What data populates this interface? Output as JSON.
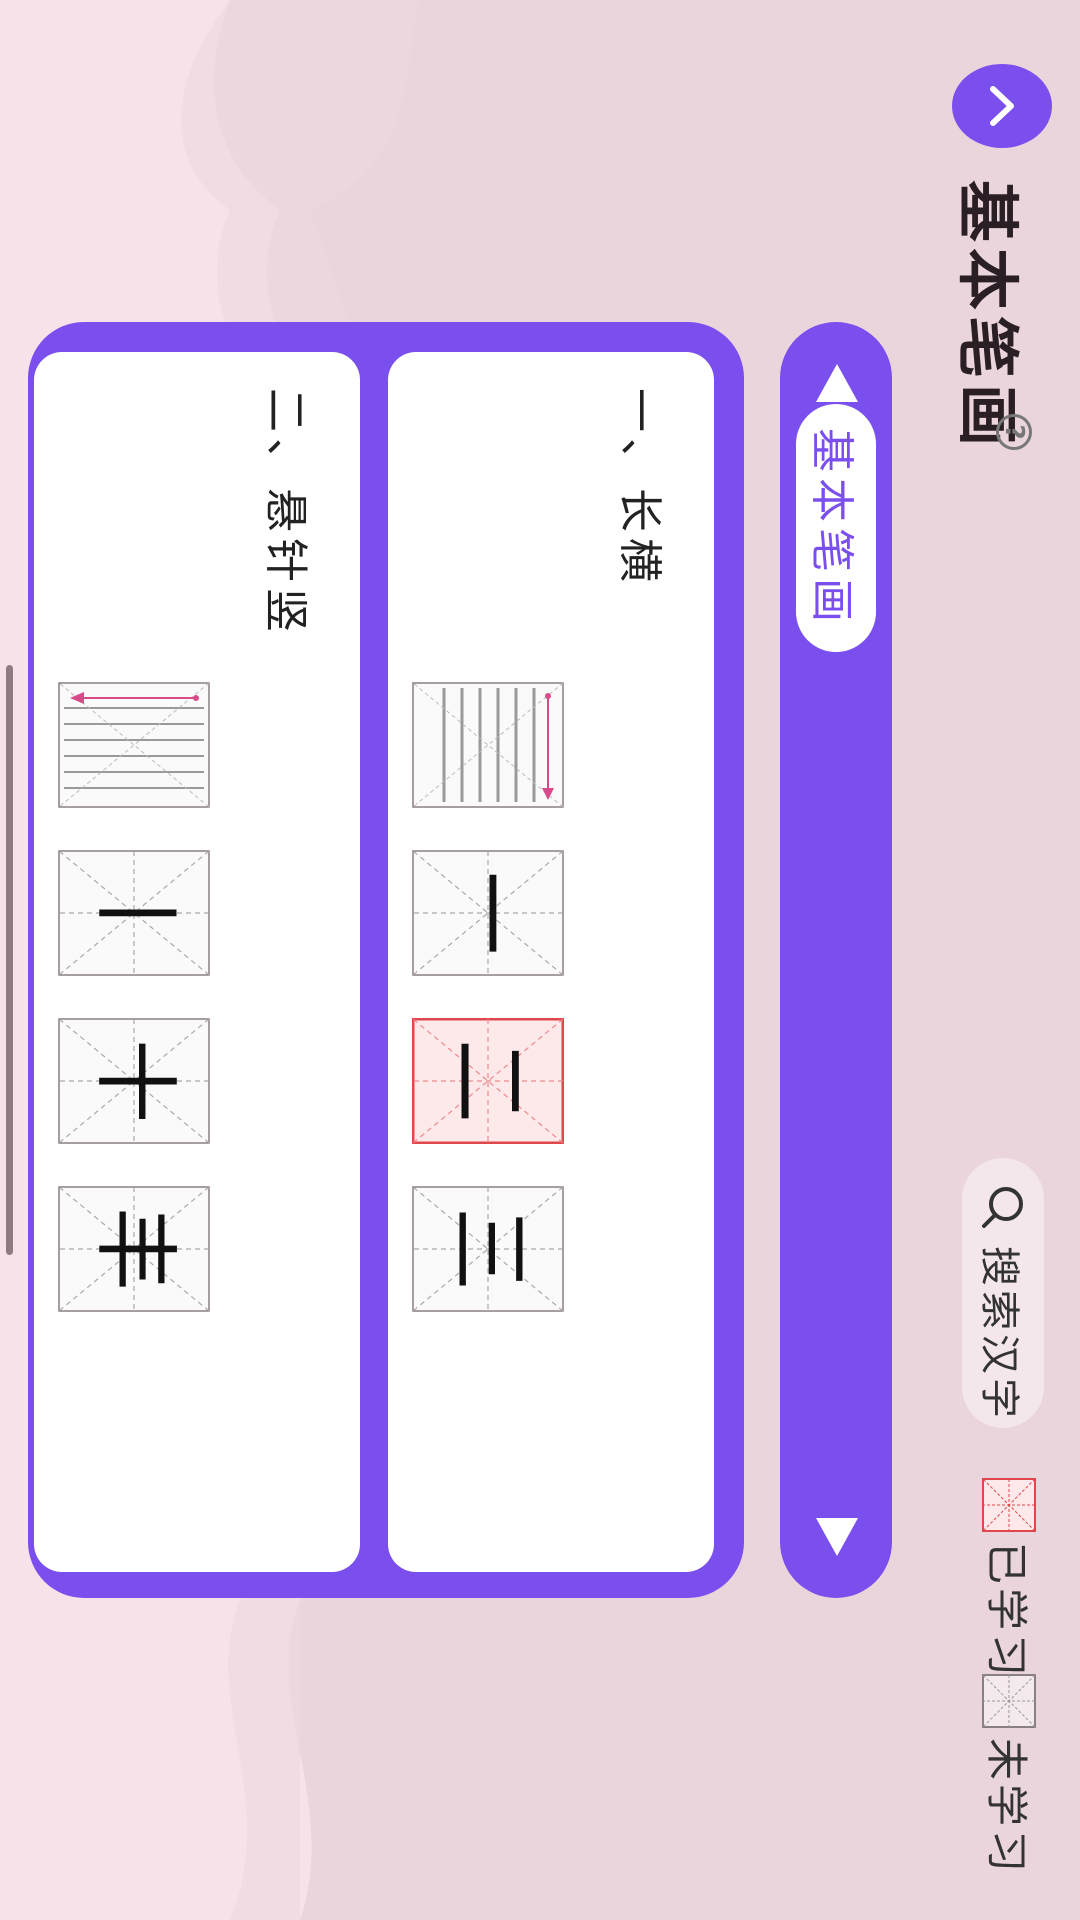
{
  "header": {
    "title": "基本笔画",
    "help": "?",
    "search_placeholder": "搜索汉字",
    "legend_learned": "已学习",
    "legend_unlearned": "未学习"
  },
  "side_nav": {
    "active_tab": "基本笔画"
  },
  "sections": [
    {
      "title": "一、长横",
      "cards": [
        {
          "kind": "demo",
          "char": ""
        },
        {
          "kind": "char",
          "char": "一",
          "learned": false
        },
        {
          "kind": "char",
          "char": "二",
          "learned": true
        },
        {
          "kind": "char",
          "char": "三",
          "learned": false
        }
      ]
    },
    {
      "title": "二、悬针竖",
      "cards": [
        {
          "kind": "demo",
          "char": ""
        },
        {
          "kind": "char",
          "char": "丨",
          "learned": false
        },
        {
          "kind": "char",
          "char": "十",
          "learned": false
        },
        {
          "kind": "char",
          "char": "丰",
          "learned": false
        }
      ]
    }
  ],
  "colors": {
    "accent": "#7b4fee",
    "learned_red": "#e0474c",
    "page_bg": "#ead5dc"
  }
}
